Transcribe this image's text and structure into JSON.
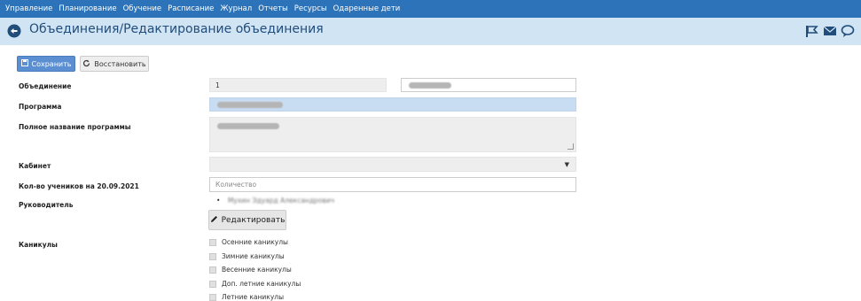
{
  "nav": {
    "items": [
      "Управление",
      "Планирование",
      "Обучение",
      "Расписание",
      "Журнал",
      "Отчеты",
      "Ресурсы",
      "Одаренные дети"
    ]
  },
  "header": {
    "title": "Объединения/Редактирование объединения",
    "icons": [
      "back-icon",
      "flag-icon",
      "mail-icon",
      "chat-icon"
    ]
  },
  "toolbar": {
    "save_label": "Сохранить",
    "restore_label": "Восстановить"
  },
  "form": {
    "association_label": "Объединение",
    "association_value": "1",
    "program_label": "Программа",
    "program_full_label": "Полное название программы",
    "room_label": "Кабинет",
    "students_label": "Кол-во учеников на 20.09.2021",
    "students_placeholder": "Количество",
    "leader_label": "Руководитель",
    "leader_name": "Мухин Эдуард Александрович",
    "edit_label": "Редактировать",
    "holidays_label": "Каникулы",
    "holidays": [
      "Осенние каникулы",
      "Зимние каникулы",
      "Весенние каникулы",
      "Доп. летние каникулы",
      "Летние каникулы"
    ]
  },
  "colors": {
    "nav_bg": "#2c73b9",
    "title_bg": "#d1e4f4",
    "title_text": "#214d7a",
    "save_bg": "#5b8fd1",
    "program_bg": "#c8dcf2"
  }
}
